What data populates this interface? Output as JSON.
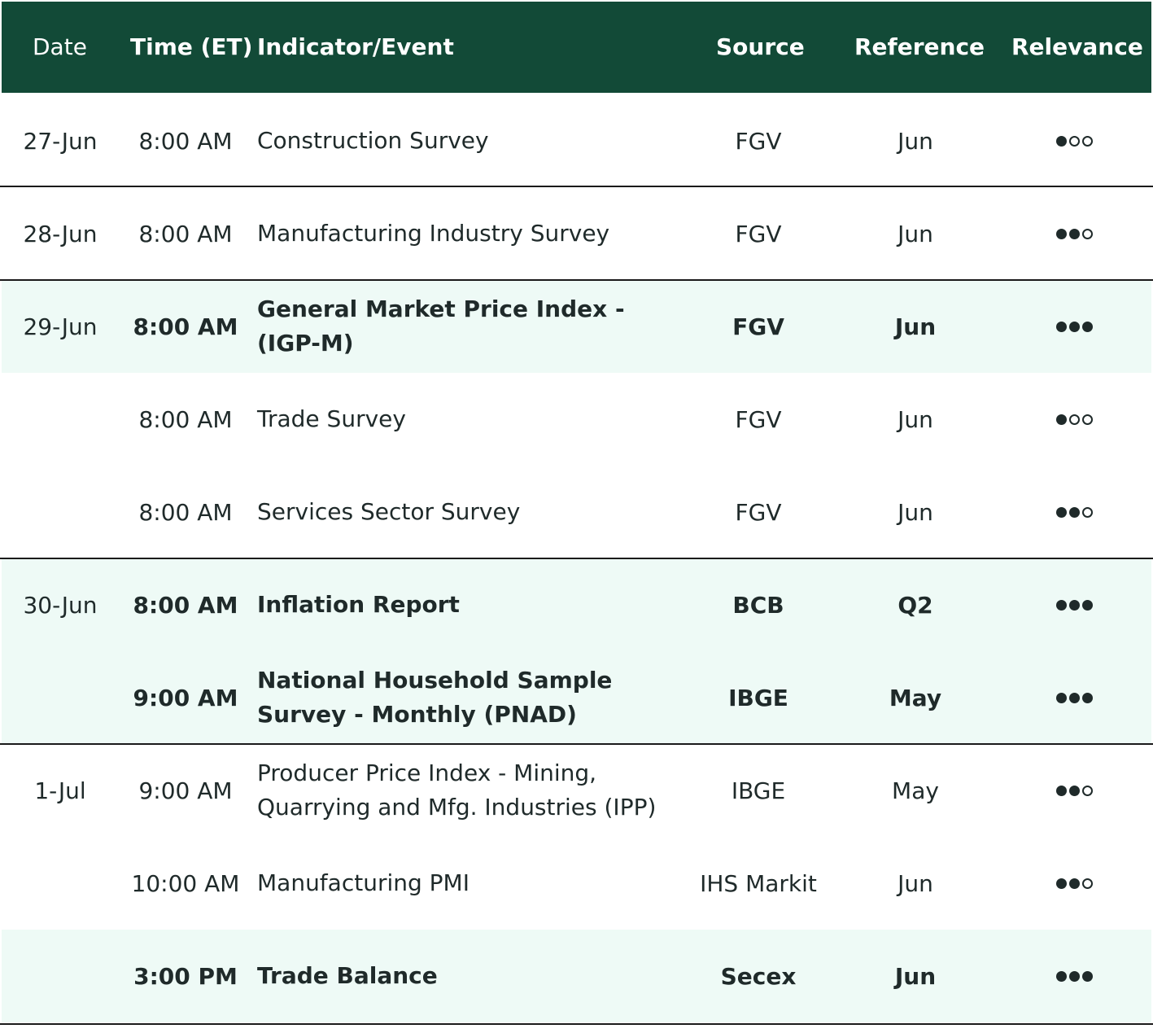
{
  "header": {
    "date": "Date",
    "time": "Time (ET)",
    "indicator": "Indicator/Event",
    "source": "Source",
    "reference": "Reference",
    "relevance": "Relevance"
  },
  "rows": [
    {
      "date": "27-Jun",
      "time": "8:00 AM",
      "indicator": "Construction Survey",
      "source": "FGV",
      "reference": "Jun",
      "relevance": 1,
      "highlighted": false
    },
    {
      "date": "28-Jun",
      "time": "8:00 AM",
      "indicator": "Manufacturing Industry Survey",
      "source": "FGV",
      "reference": "Jun",
      "relevance": 2,
      "highlighted": false
    },
    {
      "date": "29-Jun",
      "time": "8:00 AM",
      "indicator": "General Market Price Index - (IGP-M)",
      "source": "FGV",
      "reference": "Jun",
      "relevance": 3,
      "highlighted": true
    },
    {
      "date": "",
      "time": "8:00 AM",
      "indicator": "Trade Survey",
      "source": "FGV",
      "reference": "Jun",
      "relevance": 1,
      "highlighted": false
    },
    {
      "date": "",
      "time": "8:00 AM",
      "indicator": "Services Sector Survey",
      "source": "FGV",
      "reference": "Jun",
      "relevance": 2,
      "highlighted": false
    },
    {
      "date": "30-Jun",
      "time": "8:00 AM",
      "indicator": "Inflation Report",
      "source": "BCB",
      "reference": "Q2",
      "relevance": 3,
      "highlighted": true
    },
    {
      "date": "",
      "time": "9:00 AM",
      "indicator": "National Household Sample Survey - Monthly (PNAD)",
      "source": "IBGE",
      "reference": "May",
      "relevance": 3,
      "highlighted": true
    },
    {
      "date": "1-Jul",
      "time": "9:00 AM",
      "indicator": "Producer Price Index - Mining, Quarrying and Mfg. Industries (IPP)",
      "source": "IBGE",
      "reference": "May",
      "relevance": 2,
      "highlighted": false
    },
    {
      "date": "",
      "time": "10:00 AM",
      "indicator": "Manufacturing PMI",
      "source": "IHS Markit",
      "reference": "Jun",
      "relevance": 2,
      "highlighted": false
    },
    {
      "date": "",
      "time": "3:00 PM",
      "indicator": "Trade Balance",
      "source": "Secex",
      "reference": "Jun",
      "relevance": 3,
      "highlighted": true
    }
  ]
}
